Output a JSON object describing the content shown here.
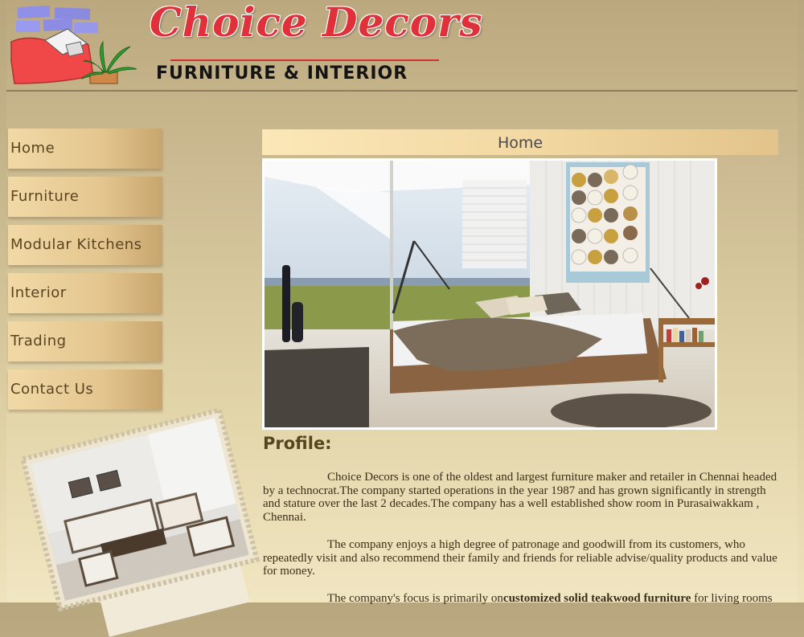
{
  "brand": {
    "name": "Choice Decors",
    "tagline": "FURNITURE & INTERIOR"
  },
  "nav": {
    "items": [
      {
        "label": "Home"
      },
      {
        "label": "Furniture"
      },
      {
        "label": "Modular Kitchens"
      },
      {
        "label": "Interior"
      },
      {
        "label": "Trading"
      },
      {
        "label": "Contact Us"
      }
    ]
  },
  "content": {
    "section_title": "Home",
    "profile_heading": "Profile:",
    "para1": "Choice Decors is one of the oldest and largest furniture maker and retailer in Chennai headed by a technocrat.The company started operations in the year 1987 and has grown significantly in strength and stature over the last 2 decades.The company has a well established show room in Purasaiwakkam , Chennai.",
    "para2": "The company enjoys a high degree of patronage and goodwill from its customers, who repeatedly visit and also recommend their family and friends for reliable advise/quality products and value for money.",
    "para3_pre": "The company's focus is primarily on",
    "para3_bold": "customized solid teakwood furniture",
    "para3_post": " for living rooms"
  },
  "colors": {
    "brand_red": "#e0303a",
    "nav_text": "#5a4422",
    "heading": "#55461f"
  }
}
